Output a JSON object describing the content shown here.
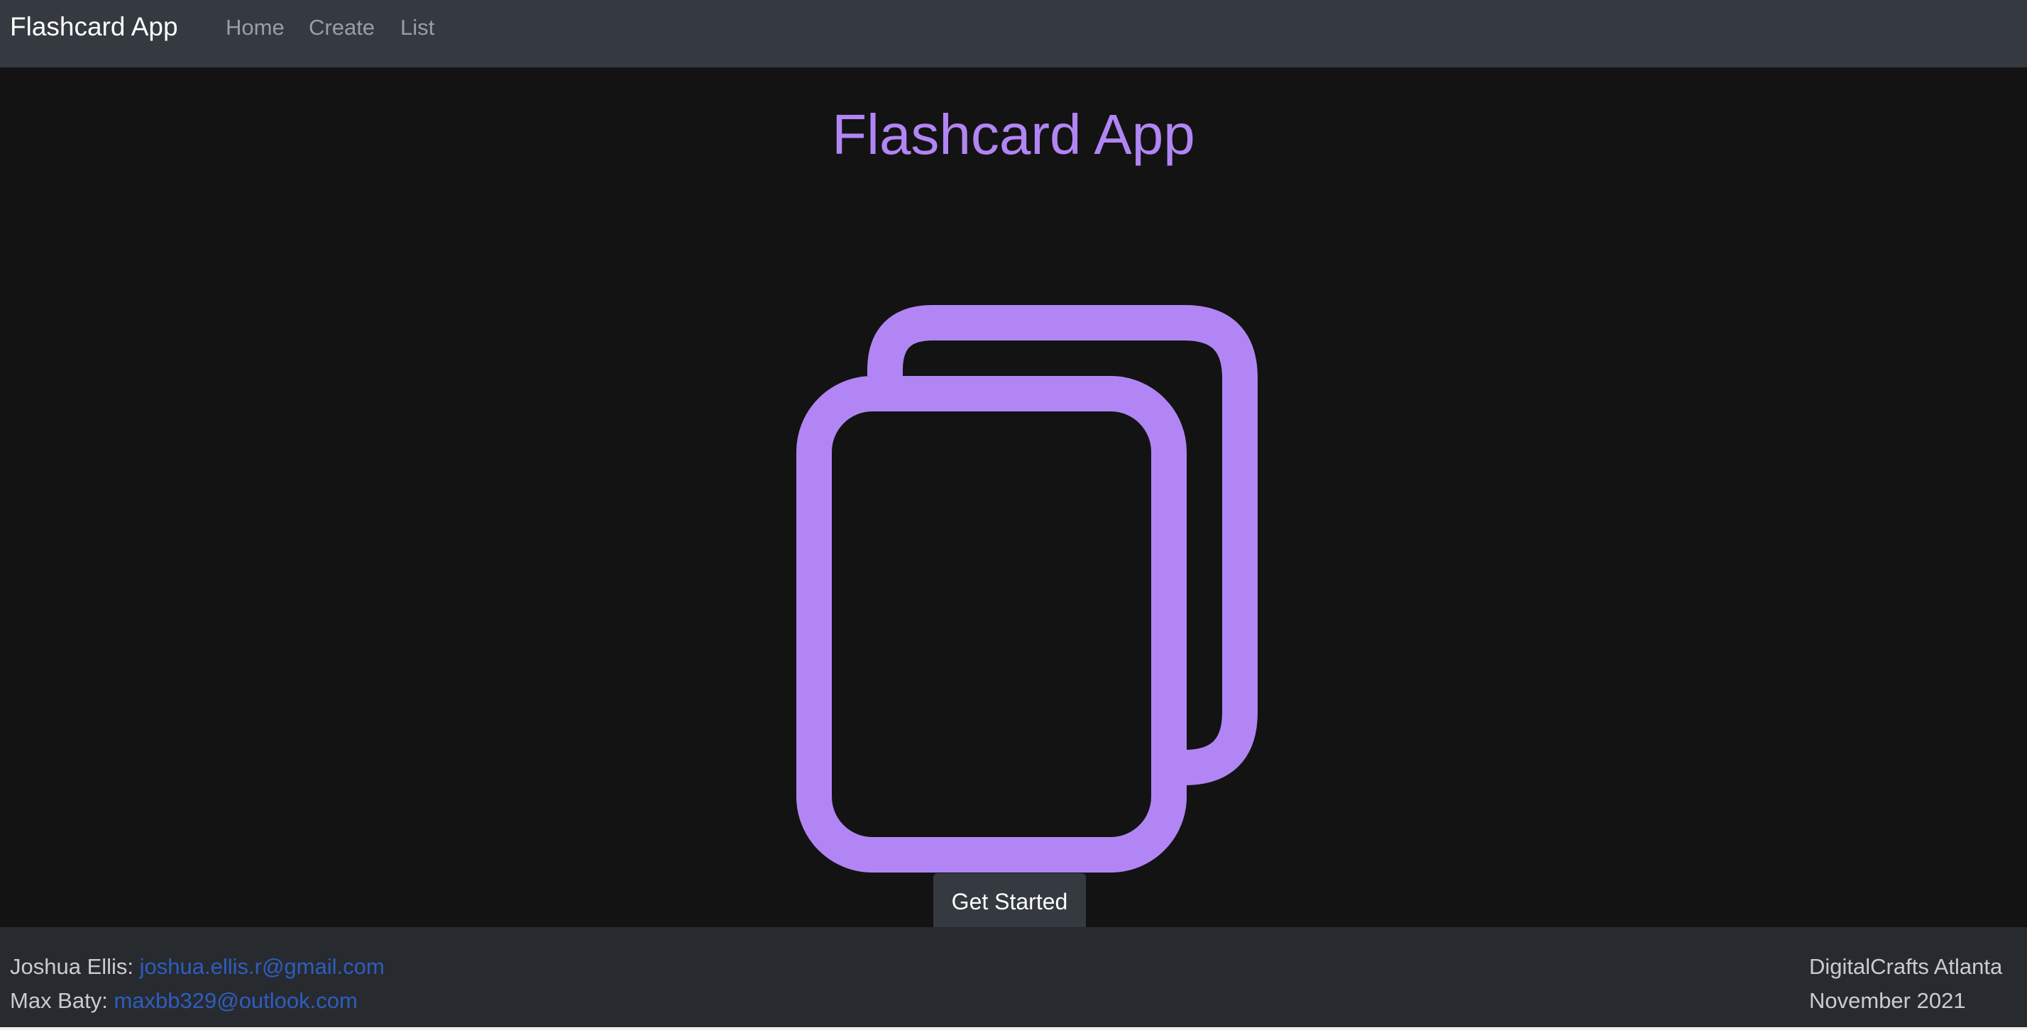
{
  "navbar": {
    "brand": "Flashcard App",
    "links": [
      {
        "label": "Home"
      },
      {
        "label": "Create"
      },
      {
        "label": "List"
      }
    ]
  },
  "main": {
    "title": "Flashcard App",
    "icon": "flashcards-icon",
    "button_label": "Get Started"
  },
  "footer": {
    "contacts": [
      {
        "name": "Joshua Ellis:",
        "email": "joshua.ellis.r@gmail.com"
      },
      {
        "name": "Max Baty:",
        "email": "maxbb329@outlook.com"
      }
    ],
    "org": "DigitalCrafts Atlanta",
    "date": "November 2021"
  },
  "colors": {
    "accent": "#b285f4",
    "navbar_bg": "#343a40",
    "page_bg": "#131313",
    "footer_bg": "#272b30",
    "link": "#2f5dbd"
  }
}
